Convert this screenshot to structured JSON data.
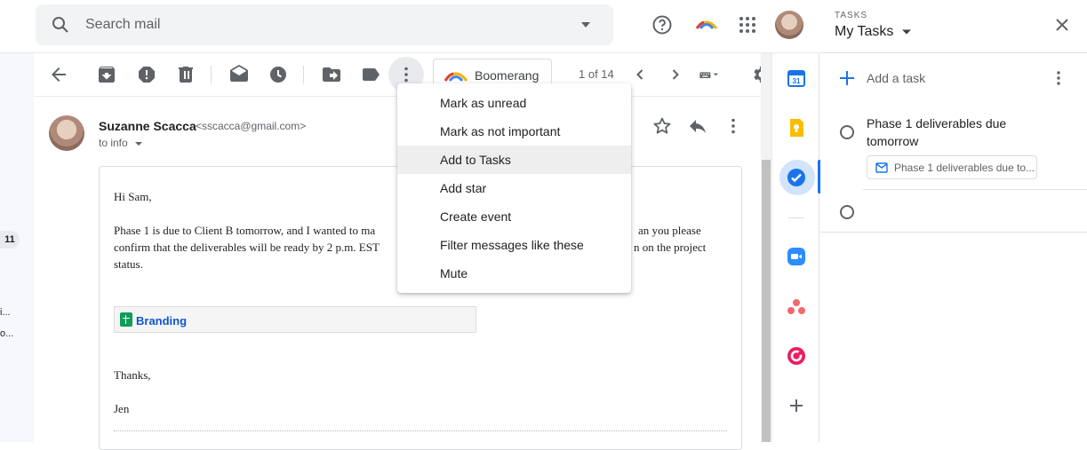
{
  "search": {
    "placeholder": "Search mail"
  },
  "left": {
    "count": "11",
    "snippet_1": "i...",
    "snippet_2": "o..."
  },
  "toolbar": {
    "boomerang_label": "Boomerang",
    "pager": "1 of 14"
  },
  "message": {
    "sender_name": "Suzanne Scacca",
    "sender_email": "<sscacca@gmail.com>",
    "to_line": "to info",
    "greeting": "Hi Sam,",
    "para_left": "Phase 1 is due to Client B tomorrow, and I wanted to ma",
    "para_right_1": "an you please",
    "para_line2_left": "confirm that the deliverables will be ready by 2 p.m. EST",
    "para_line2_right": "n on the project",
    "para_line3": "status.",
    "attachment": "Branding",
    "closing": "Thanks,",
    "signature": "Jen"
  },
  "menu": {
    "items": [
      {
        "label": "Mark as unread"
      },
      {
        "label": "Mark as not important"
      },
      {
        "label": "Add to Tasks"
      },
      {
        "label": "Add star"
      },
      {
        "label": "Create event"
      },
      {
        "label": "Filter messages like these"
      },
      {
        "label": "Mute"
      }
    ],
    "active_index": 2
  },
  "tasks": {
    "kicker": "TASKS",
    "title": "My Tasks",
    "add_task": "Add a task",
    "task1_line1": "Phase 1 deliverables due",
    "task1_line2": "tomorrow",
    "task1_link": "Phase 1 deliverables due to..."
  },
  "colors": {
    "accent_blue": "#1a73e8",
    "sheets_green": "#0f9d58",
    "zoom_blue": "#2d8cff",
    "asana_red": "#f06a6a"
  }
}
